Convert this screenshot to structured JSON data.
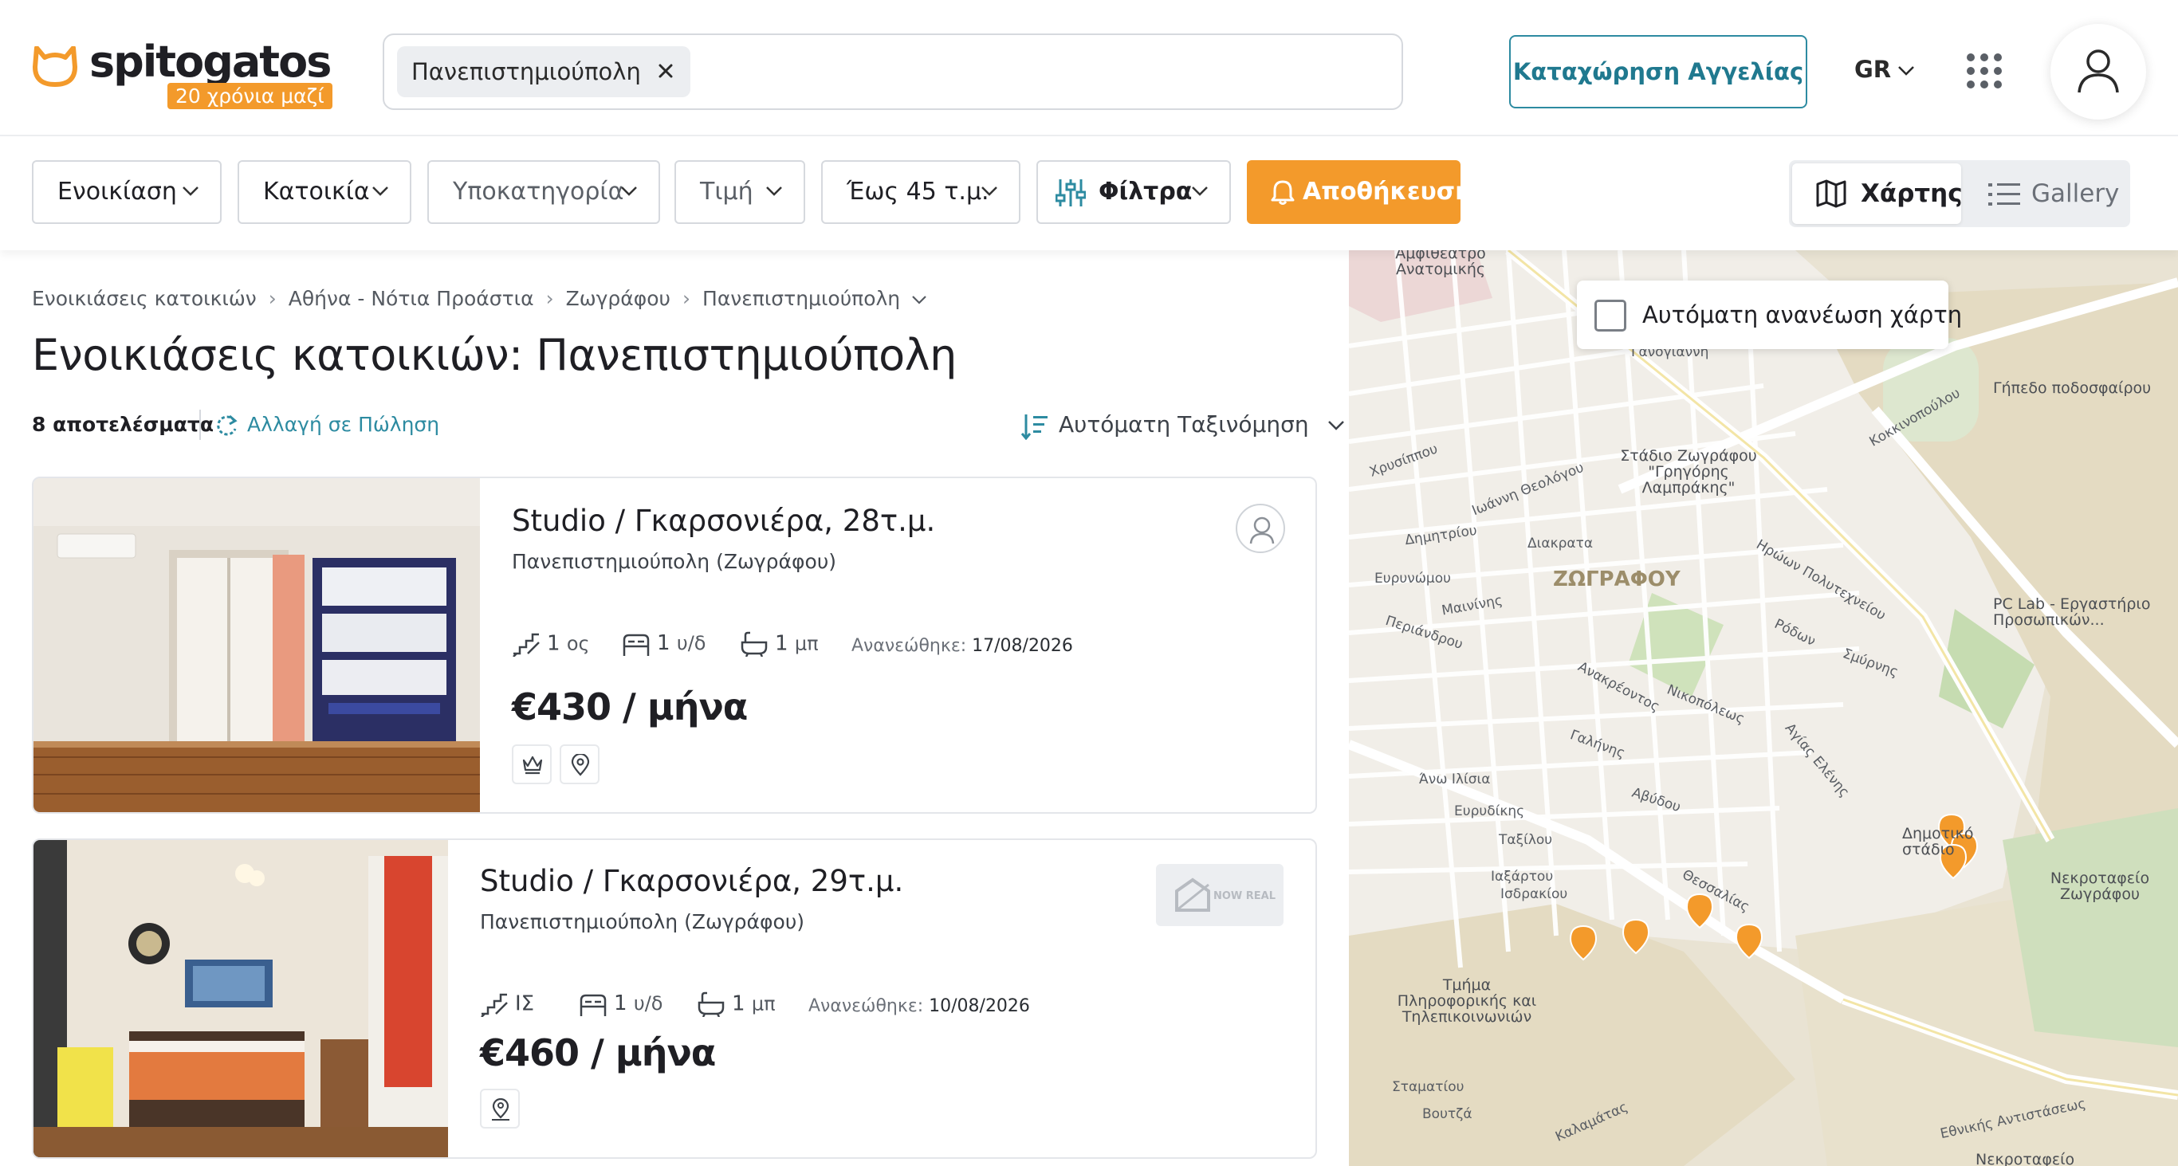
{
  "header": {
    "logo_text": "spitogatos",
    "logo_tagline": "20 χρόνια μαζί",
    "search_chip": "Πανεπιστημιούπολη",
    "list_button": "Καταχώρηση Αγγελίας",
    "language": "GR"
  },
  "filters": {
    "transaction": "Ενοικίαση",
    "category": "Κατοικία",
    "subcategory": "Υποκατηγορία",
    "price": "Τιμή",
    "area": "Έως 45 τ.μ.",
    "more": "Φίλτρα",
    "save": "Αποθήκευση",
    "view_map": "Χάρτης",
    "view_gallery": "Gallery"
  },
  "breadcrumb": [
    "Ενοικιάσεις κατοικιών",
    "Αθήνα - Νότια Προάστια",
    "Ζωγράφου",
    "Πανεπιστημιούπολη"
  ],
  "page_title": "Ενοικιάσεις κατοικιών: Πανεπιστημιούπολη",
  "results_count": "8 αποτελέσματα",
  "switch_link": "Αλλαγή σε Πώληση",
  "sort_label": "Αυτόματη Ταξινόμηση",
  "listings": [
    {
      "title": "Studio / Γκαρσονιέρα, 28τ.μ.",
      "location": "Πανεπιστημιούπολη (Ζωγράφου)",
      "floor_value": "1",
      "floor_unit": "ος",
      "bedrooms_value": "1",
      "bedrooms_unit": "υ/δ",
      "bathrooms_value": "1",
      "bathrooms_unit": "μπ",
      "updated_label": "Ανανεώθηκε:",
      "updated_date": "17/08/2026",
      "price": "€430 / μήνα"
    },
    {
      "title": "Studio / Γκαρσονιέρα, 29τ.μ.",
      "location": "Πανεπιστημιούπολη (Ζωγράφου)",
      "floor_value": "ΙΣ",
      "floor_unit": "",
      "bedrooms_value": "1",
      "bedrooms_unit": "υ/δ",
      "bathrooms_value": "1",
      "bathrooms_unit": "μπ",
      "updated_label": "Ανανεώθηκε:",
      "updated_date": "10/08/2026",
      "price": "€460 / μήνα",
      "agency_logo_text": "NOW REAL ESTATE"
    }
  ],
  "map": {
    "auto_refresh_label": "Αυτόματη ανανέωση χάρτη",
    "district_label": "ΖΩΓΡΑΦΟΥ",
    "labels": {
      "stadium": "Στάδιο Ζωγράφου \"Γρηγόρης Λαμπράκης\"",
      "football": "Γήπεδο ποδοσφαίρου",
      "pclab": "PC Lab - Εργαστήριο Προσωπικών...",
      "cemetery": "Νεκροταφείο Ζωγράφου",
      "dept": "Τμήμα Πληροφορικής και Τηλεπικοινωνιών",
      "municipal": "Δημοτικό στάδιο",
      "amfitheatre": "Αμφιθέατρο Ανατομικής",
      "cemetery_bottom": "Νεκροταφείο",
      "ethnikis": "Εθνικής Αντιστάσεως"
    },
    "streets": [
      "Ιωάννη Θεολόγου",
      "Ηρώων Πολυτεχνείου",
      "Διακρατα",
      "Ανακρέοντος",
      "Νικοπόλεως",
      "Γαλήνης",
      "Αβύδου",
      "Ευρυνώμου",
      "Αγίας Ελένης",
      "Περιάνδρου",
      "Άνω Ιλίσια",
      "Ευρυδίκης",
      "Δημητρίου",
      "Σμύρνης",
      "Ρόδων",
      "Ταξίλου",
      "Ιαξάρτου",
      "Κοκκινοπούλου",
      "Ευρυνώμου",
      "Χρυσίππου",
      "Μαινίνης",
      "Ισδρακίου",
      "Θεσσαλίας",
      "Καλαμάτας",
      "Γανογιάννη",
      "Βουτζά",
      "Σταματίου"
    ],
    "accent_pin_color": "#f39a2b"
  },
  "colors": {
    "brand_orange": "#f39a2b",
    "teal": "#2d8ba1",
    "text": "#1f1f24"
  }
}
